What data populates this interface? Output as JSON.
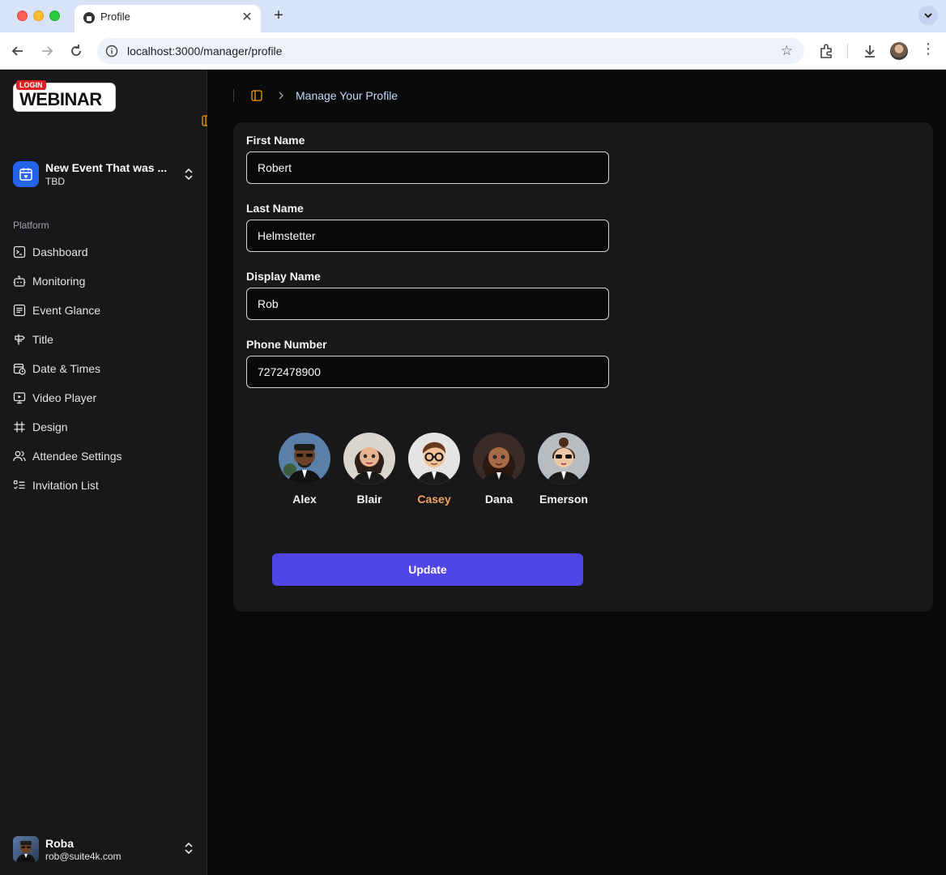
{
  "browser": {
    "tab_title": "Profile",
    "url": "localhost:3000/manager/profile"
  },
  "sidebar": {
    "logo_text": "WEBINAR",
    "logo_badge": "LOGIN",
    "event": {
      "title": "New Event That was ...",
      "subtitle": "TBD"
    },
    "section_label": "Platform",
    "items": [
      {
        "label": "Dashboard",
        "icon": "dashboard-icon"
      },
      {
        "label": "Monitoring",
        "icon": "bot-icon"
      },
      {
        "label": "Event Glance",
        "icon": "list-icon"
      },
      {
        "label": "Title",
        "icon": "signpost-icon"
      },
      {
        "label": "Date & Times",
        "icon": "calendar-clock-icon"
      },
      {
        "label": "Video Player",
        "icon": "monitor-play-icon"
      },
      {
        "label": "Design",
        "icon": "hash-icon"
      },
      {
        "label": "Attendee Settings",
        "icon": "users-icon"
      },
      {
        "label": "Invitation List",
        "icon": "list-checks-icon"
      }
    ],
    "user": {
      "name": "Roba",
      "email": "rob@suite4k.com"
    }
  },
  "header": {
    "breadcrumb": "Manage Your Profile"
  },
  "form": {
    "first_name": {
      "label": "First Name",
      "value": "Robert"
    },
    "last_name": {
      "label": "Last Name",
      "value": "Helmstetter"
    },
    "display_name": {
      "label": "Display Name",
      "value": "Rob"
    },
    "phone": {
      "label": "Phone Number",
      "value": "7272478900"
    },
    "avatars": [
      {
        "name": "Alex",
        "selected": false
      },
      {
        "name": "Blair",
        "selected": false
      },
      {
        "name": "Casey",
        "selected": true
      },
      {
        "name": "Dana",
        "selected": false
      },
      {
        "name": "Emerson",
        "selected": false
      }
    ],
    "submit_label": "Update"
  },
  "colors": {
    "accent": "#4f46e5",
    "selected_avatar_label": "#f5a25d",
    "breadcrumb": "#bfdbfe",
    "event_icon_bg": "#2563eb"
  }
}
